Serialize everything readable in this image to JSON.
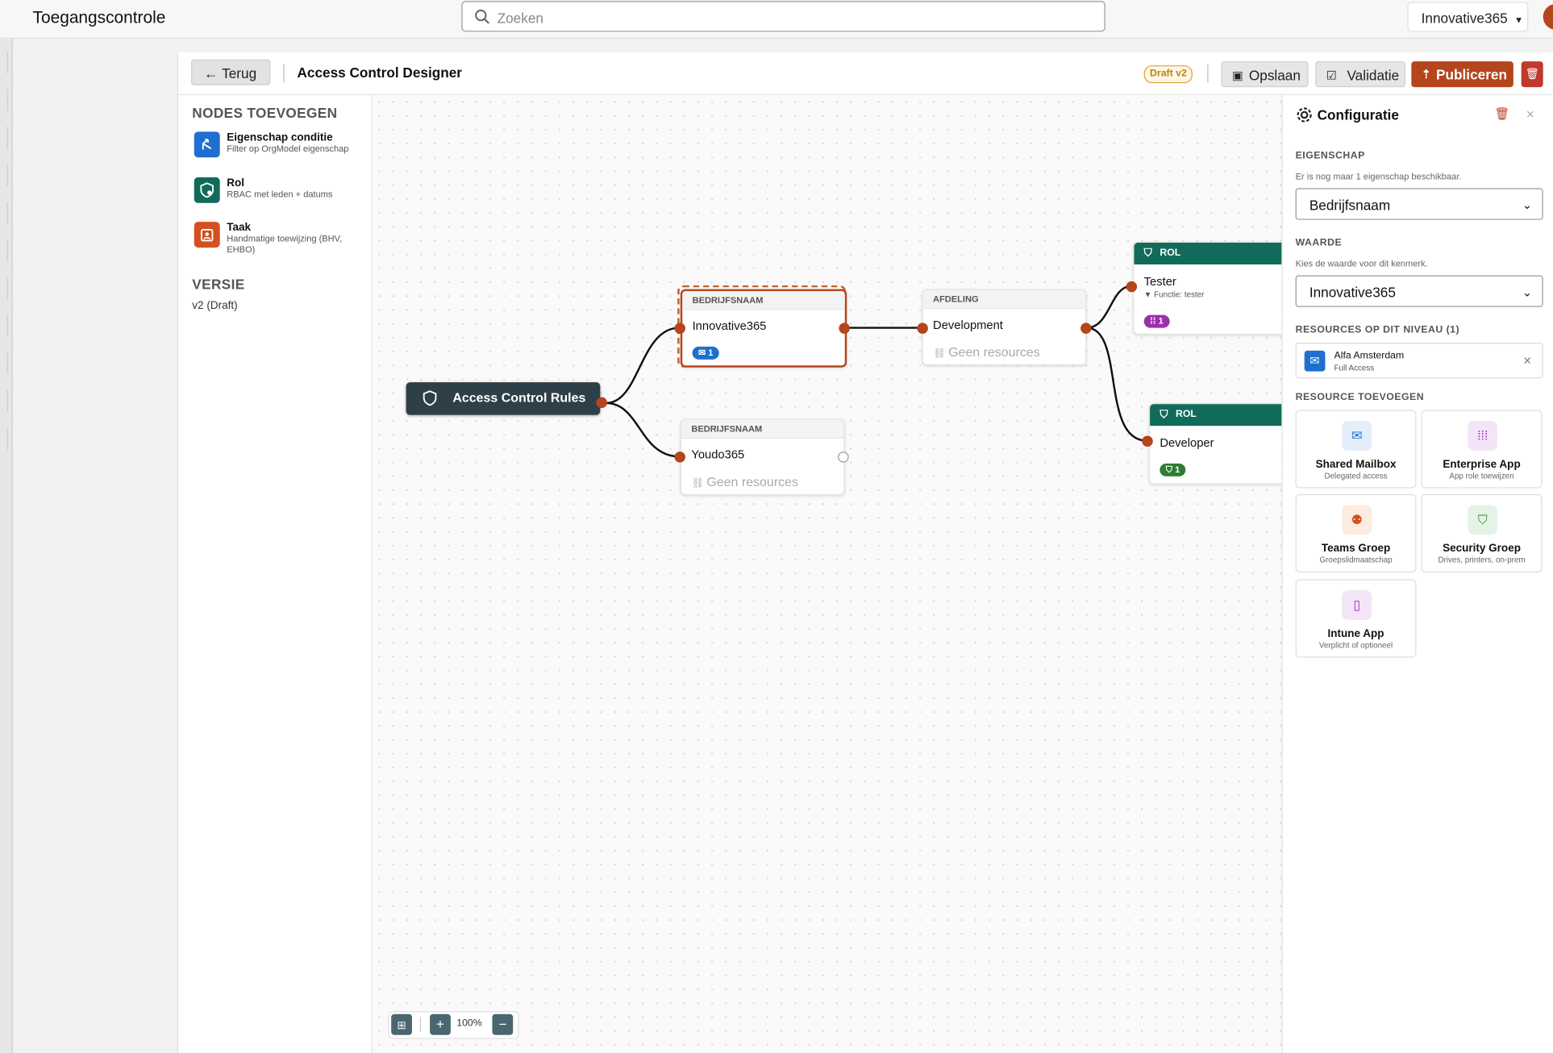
{
  "app": {
    "title": "Toegangscontrole"
  },
  "search": {
    "placeholder": "Zoeken"
  },
  "tenant": {
    "label": "Innovative365"
  },
  "toolbar": {
    "back_label": "Terug",
    "title": "Access Control Designer",
    "draft_badge": "Draft v2",
    "save_label": "Opslaan",
    "validate_label": "Validatie",
    "publish_label": "Publiceren"
  },
  "palette": {
    "title": "NODES TOEVOEGEN",
    "items": [
      {
        "label": "Eigenschap conditie",
        "description": "Filter op OrgModel eigenschap",
        "icon": "branch-icon",
        "color": "#1e6fd0"
      },
      {
        "label": "Rol",
        "description": "RBAC met leden + datums",
        "icon": "shield-user-icon",
        "color": "#116b5a"
      },
      {
        "label": "Taak",
        "description": "Handmatige toewijzing (BHV, EHBO)",
        "icon": "badge-icon",
        "color": "#d4501f"
      }
    ],
    "version_title": "VERSIE",
    "version_value": "v2 (Draft)"
  },
  "canvas": {
    "root": {
      "label": "Access Control Rules"
    },
    "nodes": {
      "innovative": {
        "header": "BEDRIJFSNAAM",
        "name": "Innovative365",
        "chip": "1"
      },
      "youdo": {
        "header": "BEDRIJFSNAAM",
        "name": "Youdo365",
        "no_resources": "Geen resources"
      },
      "development": {
        "header": "AFDELING",
        "name": "Development",
        "no_resources": "Geen resources"
      },
      "tester": {
        "header": "ROL",
        "name": "Tester",
        "filter": "Functie: tester",
        "chip": "1"
      },
      "developer": {
        "header": "ROL",
        "name": "Developer",
        "chip": "1"
      }
    },
    "zoom": "100%"
  },
  "config": {
    "title": "Configuratie",
    "property": {
      "title": "EIGENSCHAP",
      "help": "Er is nog maar 1 eigenschap beschikbaar.",
      "value": "Bedrijfsnaam"
    },
    "value": {
      "title": "WAARDE",
      "help": "Kies de waarde voor dit kenmerk.",
      "value": "Innovative365"
    },
    "resources": {
      "title": "RESOURCES OP DIT NIVEAU (1)",
      "items": [
        {
          "name": "Alfa Amsterdam",
          "access": "Full Access"
        }
      ]
    },
    "add_resource": {
      "title": "RESOURCE TOEVOEGEN",
      "tiles": [
        {
          "label": "Shared Mailbox",
          "description": "Delegated access",
          "icon": "mail-icon",
          "color": "#1e6fd0"
        },
        {
          "label": "Enterprise App",
          "description": "App role toewijzen",
          "icon": "grid-icon",
          "color": "#9b2fae"
        },
        {
          "label": "Teams Groep",
          "description": "Groepslidmaatschap",
          "icon": "people-icon",
          "color": "#d4501f"
        },
        {
          "label": "Security Groep",
          "description": "Drives, printers, on-prem",
          "icon": "shield-icon",
          "color": "#2e8b3a"
        },
        {
          "label": "Intune App",
          "description": "Verplicht of optioneel",
          "icon": "device-icon",
          "color": "#8e2fae"
        }
      ]
    }
  },
  "colors": {
    "accent": "#b5451b",
    "role_header": "#116b5a",
    "root_node": "#2f3f47"
  }
}
